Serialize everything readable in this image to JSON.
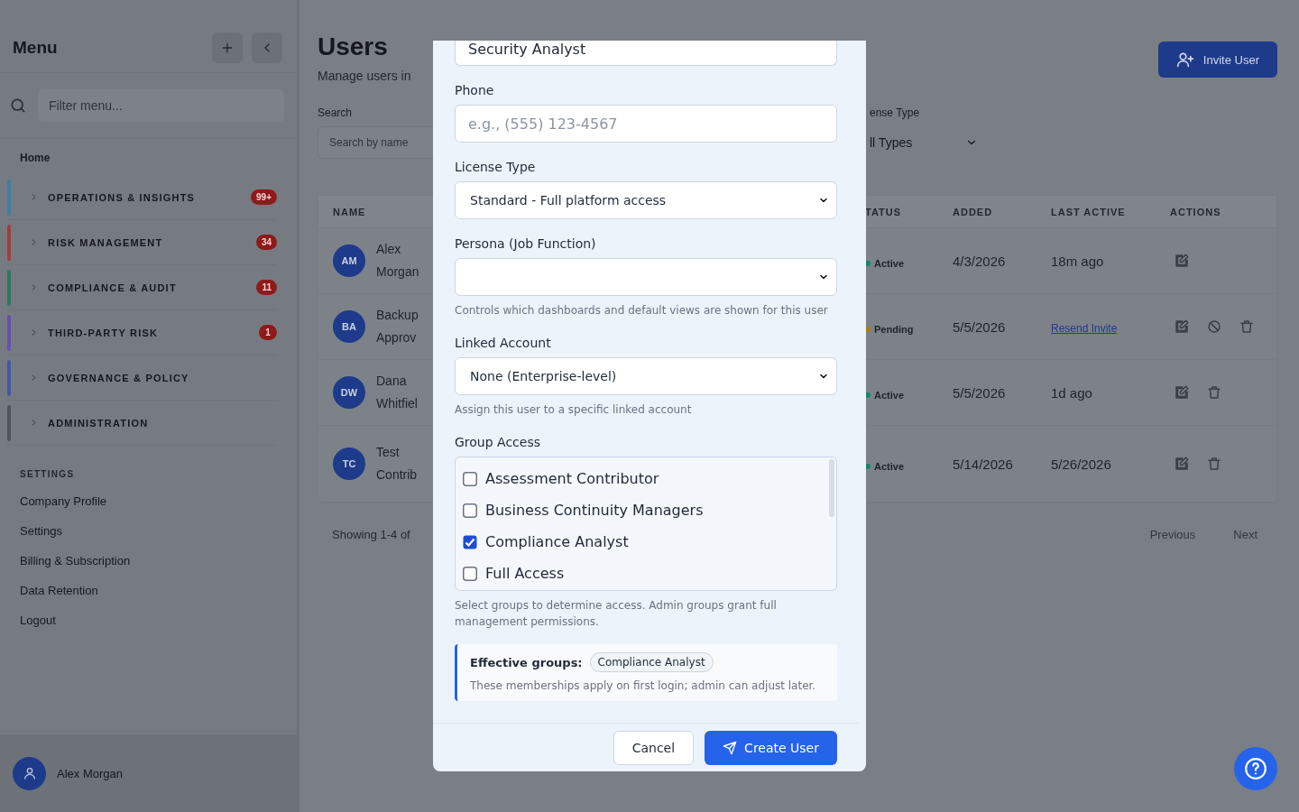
{
  "sidebar": {
    "title": "Menu",
    "filter_placeholder": "Filter menu...",
    "home": "Home",
    "sections": [
      {
        "label": "OPERATIONS & INSIGHTS",
        "badge": "99+",
        "color": "#3d7ea6"
      },
      {
        "label": "RISK MANAGEMENT",
        "badge": "34",
        "color": "#a33d3d"
      },
      {
        "label": "COMPLIANCE & AUDIT",
        "badge": "11",
        "color": "#2d7a5a"
      },
      {
        "label": "THIRD-PARTY RISK",
        "badge": "1",
        "color": "#6a4db5"
      },
      {
        "label": "GOVERNANCE & POLICY",
        "color": "#4257a8"
      },
      {
        "label": "ADMINISTRATION",
        "color": "#50555c"
      }
    ],
    "settings_heading": "SETTINGS",
    "settings_items": [
      "Company Profile",
      "Settings",
      "Billing & Subscription",
      "Data Retention",
      "Logout"
    ],
    "user": {
      "name": "Alex Morgan"
    }
  },
  "page": {
    "title": "Users",
    "subtitle": "Manage users in",
    "search_label": "Search",
    "search_placeholder": "Search by name",
    "type_label": "ense Type",
    "type_value": "ll Types",
    "invite_button": "Invite User"
  },
  "table": {
    "columns": [
      "NAME",
      "TATUS",
      "ADDED",
      "LAST ACTIVE",
      "ACTIONS"
    ],
    "rows": [
      {
        "initials": "AM",
        "name": "Alex Morgan",
        "status": "Active",
        "color": "#0f8a62",
        "added": "4/3/2026",
        "last_active": {
          "text": "18m ago",
          "kind": "text"
        },
        "actions": [
          {
            "kind": "edit"
          }
        ]
      },
      {
        "initials": "BA",
        "name": "Backup Approv",
        "status": "Pending",
        "color": "#b87716",
        "added": "5/5/2026",
        "last_active": {
          "text": "Resend Invite",
          "kind": "link"
        },
        "actions": [
          {
            "kind": "edit"
          },
          {
            "kind": "block"
          },
          {
            "kind": "trash"
          }
        ]
      },
      {
        "initials": "DW",
        "name": "Dana Whitfiel",
        "status": "Active",
        "color": "#0f8a62",
        "added": "5/5/2026",
        "last_active": {
          "text": "1d ago",
          "kind": "text"
        },
        "actions": [
          {
            "kind": "edit"
          },
          {
            "kind": "trash"
          }
        ]
      },
      {
        "initials": "TC",
        "name": "Test Contrib",
        "status": "Active",
        "color": "#0f8a62",
        "added": "5/14/2026",
        "last_active": {
          "text": "5/26/2026",
          "kind": "text"
        },
        "actions": [
          {
            "kind": "edit"
          },
          {
            "kind": "trash"
          }
        ]
      }
    ]
  },
  "pager": {
    "showing": "Showing 1-4 of",
    "previous": "Previous",
    "next": "Next"
  },
  "modal": {
    "fields": [
      {
        "kind": "text",
        "value": "Security Analyst"
      },
      {
        "kind": "text",
        "label": "Phone",
        "placeholder": "e.g., (555) 123-4567"
      },
      {
        "kind": "select",
        "label": "License Type",
        "value": "Standard - Full platform access"
      },
      {
        "kind": "select",
        "label": "Persona (Job Function)",
        "hint": "Controls which dashboards and default views are shown for this user"
      },
      {
        "kind": "select",
        "label": "Linked Account",
        "value": "None (Enterprise-level)",
        "hint": "Assign this user to a specific linked account"
      },
      {
        "kind": "checklist",
        "label": "Group Access",
        "hint": "Select groups to determine access. Admin groups grant full management permissions.",
        "options": [
          {
            "label": "Assessment Contributor",
            "checked": false
          },
          {
            "label": "Business Continuity Managers",
            "checked": false
          },
          {
            "label": "Compliance Analyst",
            "checked": true
          },
          {
            "label": "Full Access",
            "checked": false
          }
        ]
      }
    ],
    "effective": {
      "label": "Effective groups:",
      "chips": [
        "Compliance Analyst"
      ],
      "note": "These memberships apply on first login; admin can adjust later."
    },
    "buttons": [
      {
        "label": "Cancel",
        "kind": "secondary"
      },
      {
        "label": "Create User",
        "kind": "primary"
      }
    ]
  }
}
